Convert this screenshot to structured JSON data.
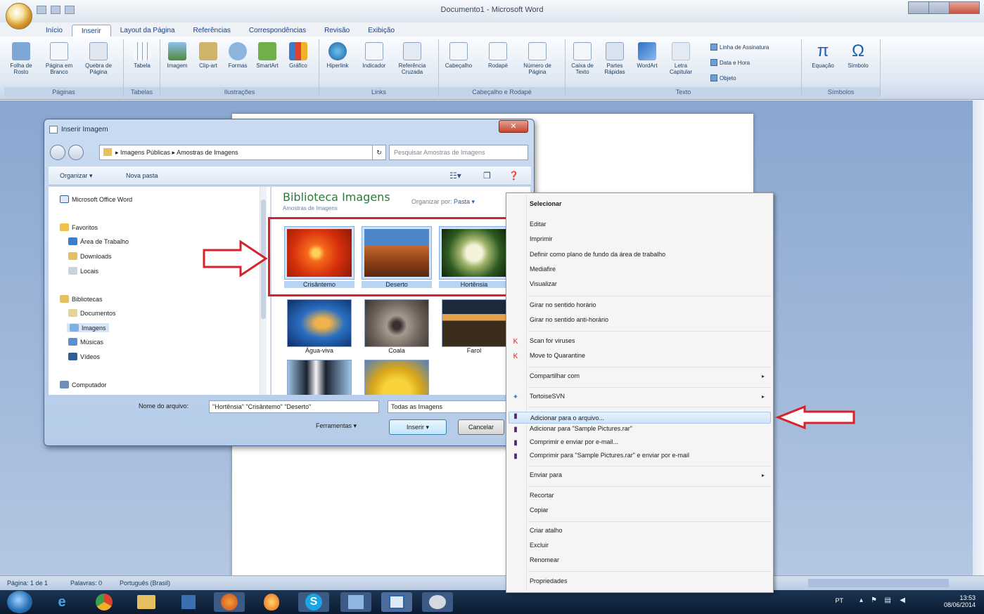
{
  "window": {
    "title": "Documento1 - Microsoft Word",
    "tabs": [
      "Início",
      "Inserir",
      "Layout da Página",
      "Referências",
      "Correspondências",
      "Revisão",
      "Exibição"
    ],
    "active_tab": "Inserir"
  },
  "ribbon": {
    "groups": [
      "Páginas",
      "Tabelas",
      "Ilustrações",
      "Links",
      "Cabeçalho e Rodapé",
      "Texto",
      "Símbolos"
    ],
    "commands": [
      "Folha de Rosto",
      "Página em Branco",
      "Quebra de Página",
      "Tabela",
      "Imagem",
      "Clip-art",
      "Formas",
      "SmartArt",
      "Gráfico",
      "Hiperlink",
      "Indicador",
      "Referência Cruzada",
      "Cabeçalho",
      "Rodapé",
      "Número de Página",
      "Caixa de Texto",
      "Partes Rápidas",
      "WordArt",
      "Letra Capitular",
      "Equação",
      "Símbolo"
    ],
    "small": [
      "Linha de Assinatura",
      "Data e Hora",
      "Objeto"
    ]
  },
  "dialog": {
    "title": "Inserir Imagem",
    "address": "▸ Imagens Públicas ▸ Amostras de Imagens",
    "search_placeholder": "Pesquisar Amostras de Imagens",
    "organize": "Organizar ▾",
    "new_folder": "Nova pasta",
    "nav": {
      "word": "Microsoft Office Word",
      "favorites": "Favoritos",
      "desktop": "Área de Trabalho",
      "downloads": "Downloads",
      "places": "Locais",
      "libraries": "Bibliotecas",
      "documents": "Documentos",
      "images": "Imagens",
      "music": "Músicas",
      "videos": "Vídeos",
      "computer": "Computador"
    },
    "library_title": "Biblioteca Imagens",
    "library_sub": "Amostras de Imagens",
    "organize_by": "Organizar por:",
    "organize_by_value": "Pasta ▾",
    "thumbnails": [
      "Crisântemo",
      "Deserto",
      "Hortênsia",
      "Água-viva",
      "Coala",
      "Farol"
    ],
    "filename_label": "Nome do arquivo:",
    "filename_value": "\"Hortênsia\" \"Crisântemo\" \"Deserto\"",
    "filetype_value": "Todas as Imagens",
    "tools_label": "Ferramentas",
    "insert_label": "Inserir",
    "cancel_label": "Cancelar"
  },
  "context_menu": {
    "items": [
      {
        "label": "Selecionar",
        "bold": true
      },
      {
        "label": "Editar"
      },
      {
        "label": "Imprimir"
      },
      {
        "label": "Definir como plano de fundo da área de trabalho"
      },
      {
        "label": "Mediafire"
      },
      {
        "label": "Visualizar"
      },
      {
        "label": "Girar no sentido horário"
      },
      {
        "label": "Girar no sentido anti-horário"
      },
      {
        "label": "Scan for viruses"
      },
      {
        "label": "Move to Quarantine"
      },
      {
        "label": "Compartilhar com"
      },
      {
        "label": "TortoiseSVN"
      },
      {
        "label": "Adicionar para o arquivo..."
      },
      {
        "label": "Adicionar para \"Sample Pictures.rar\""
      },
      {
        "label": "Comprimir e enviar por e-mail..."
      },
      {
        "label": "Comprimir para \"Sample Pictures.rar\" e enviar por e-mail"
      },
      {
        "label": "Enviar para"
      },
      {
        "label": "Recortar"
      },
      {
        "label": "Copiar"
      },
      {
        "label": "Criar atalho"
      },
      {
        "label": "Excluir"
      },
      {
        "label": "Renomear"
      },
      {
        "label": "Propriedades"
      }
    ]
  },
  "statusbar": {
    "page": "Página: 1 de 1",
    "words": "Palavras: 0",
    "language": "Português (Brasil)"
  },
  "taskbar": {
    "lang": "PT",
    "time": "13:53",
    "date": "08/06/2014"
  },
  "colors": {
    "highlight_red": "#d8222b",
    "ribbon_blue": "#dfe8f3",
    "doc_background": "#9eb6d9"
  }
}
